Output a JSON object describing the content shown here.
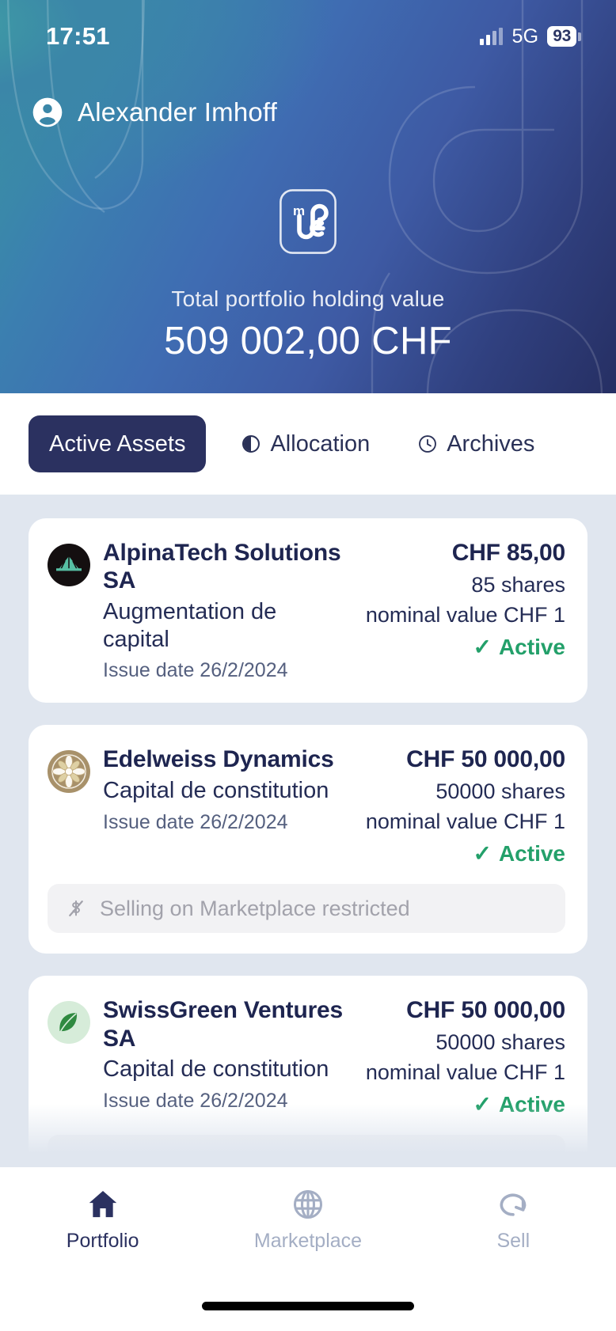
{
  "status_bar": {
    "time": "17:51",
    "network": "5G",
    "battery": "93",
    "signal_icon": "signal-bars-icon",
    "battery_icon": "battery-icon"
  },
  "header": {
    "user_name": "Alexander Imhoff",
    "avatar_icon": "user-avatar-icon",
    "brand_logo_icon": "mdc-brand-logo",
    "total_label": "Total portfolio holding value",
    "total_value": "509 002,00 CHF",
    "gradient_from": "#38989f",
    "gradient_to": "#262f63"
  },
  "tabs": [
    {
      "label": "Active Assets",
      "icon": "",
      "active": true
    },
    {
      "label": "Allocation",
      "icon": "pie-chart-icon",
      "active": false
    },
    {
      "label": "Archives",
      "icon": "clock-icon",
      "active": false
    }
  ],
  "assets": [
    {
      "logo_icon": "alpinatech-mountain-logo",
      "name": "AlpinaTech Solutions SA",
      "type": "Augmentation de capital",
      "issue_date": "Issue date 26/2/2024",
      "value": "CHF 85,00",
      "shares": "85 shares",
      "nominal": "nominal value CHF  1",
      "status": "Active",
      "status_icon": "check-icon",
      "restricted": null
    },
    {
      "logo_icon": "edelweiss-flower-logo",
      "name": "Edelweiss Dynamics",
      "type": "Capital de constitution",
      "issue_date": "Issue date 26/2/2024",
      "value": "CHF 50 000,00",
      "shares": "50000 shares",
      "nominal": "nominal value CHF  1",
      "status": "Active",
      "status_icon": "check-icon",
      "restricted": "Selling on Marketplace restricted",
      "restricted_icon": "no-money-icon"
    },
    {
      "logo_icon": "swissgreen-leaf-logo",
      "name": "SwissGreen Ventures SA",
      "type": "Capital de constitution",
      "issue_date": "Issue date 26/2/2024",
      "value": "CHF 50 000,00",
      "shares": "50000 shares",
      "nominal": "nominal value CHF  1",
      "status": "Active",
      "status_icon": "check-icon",
      "restricted": null
    }
  ],
  "bottom_nav": [
    {
      "label": "Portfolio",
      "icon": "home-icon",
      "active": true
    },
    {
      "label": "Marketplace",
      "icon": "globe-icon",
      "active": false
    },
    {
      "label": "Sell",
      "icon": "rotate-icon",
      "active": false
    }
  ],
  "colors": {
    "accent_navy": "#2b3160",
    "status_green": "#23a06a",
    "list_background": "#e0e6ef",
    "muted_text": "#a4aec4"
  }
}
